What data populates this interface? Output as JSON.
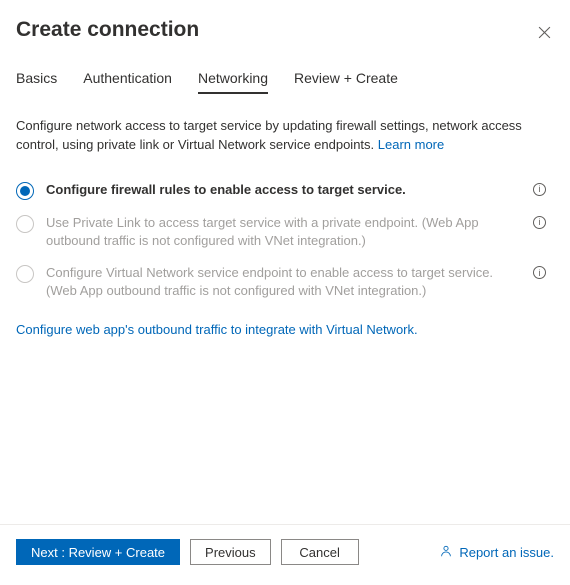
{
  "header": {
    "title": "Create connection"
  },
  "tabs": [
    {
      "label": "Basics"
    },
    {
      "label": "Authentication"
    },
    {
      "label": "Networking"
    },
    {
      "label": "Review + Create"
    }
  ],
  "description": {
    "text": "Configure network access to target service by updating firewall settings, network access control, using private link or Virtual Network service endpoints. ",
    "learn_more": "Learn more"
  },
  "options": [
    {
      "label": "Configure firewall rules to enable access to target service.",
      "selected": true,
      "enabled": true,
      "info_inline": true
    },
    {
      "label": "Use Private Link to access target service with a private endpoint. (Web App outbound traffic is not configured with VNet integration.)",
      "selected": false,
      "enabled": false,
      "info_right": true
    },
    {
      "label": "Configure Virtual Network service endpoint to enable access to target service. (Web App outbound traffic is not configured with VNet integration.)",
      "selected": false,
      "enabled": false,
      "info_right": true
    }
  ],
  "outbound_link": "Configure web app's outbound traffic to integrate with Virtual Network.",
  "footer": {
    "next": "Next : Review + Create",
    "previous": "Previous",
    "cancel": "Cancel",
    "report": "Report an issue."
  }
}
